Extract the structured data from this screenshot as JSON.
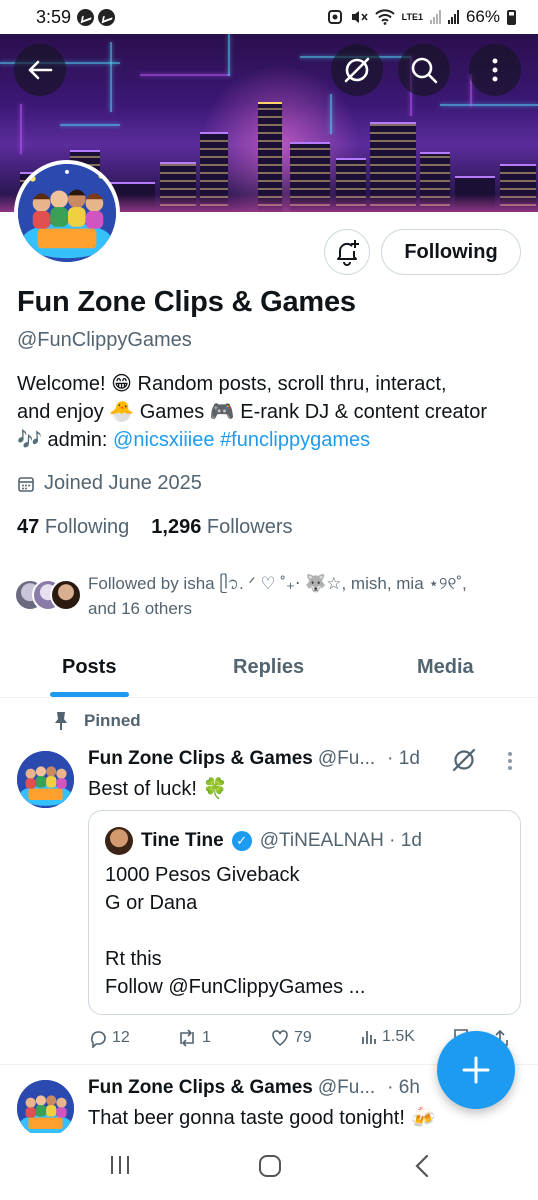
{
  "status_bar": {
    "time": "3:59",
    "network": "LTE1",
    "battery": "66%"
  },
  "header": {
    "back_icon": "arrow-left-icon",
    "grok_icon": "slashed-circle-icon",
    "search_icon": "search-icon",
    "more_icon": "more-vertical-icon"
  },
  "profile": {
    "name": "Fun Zone Clips & Games",
    "handle": "@FunClippyGames",
    "bio_line1": "Welcome! 😁 Random posts, scroll thru, interact,",
    "bio_line2": "and enjoy 🐣 Games 🎮 E-rank DJ & content creator",
    "bio_line3_prefix": "🎶 admin: ",
    "bio_mention": "@nicsxiiiee",
    "bio_hashtag": "#funclippygames",
    "joined": "Joined June 2025",
    "following_count": "47",
    "following_label": "Following",
    "followers_count": "1,296",
    "followers_label": "Followers",
    "followed_by_line1": "Followed by isha ᥫ᭡. ᐟ ♡ ˚₊‧ 🐺☆, mish, mia ⋆୨୧˚,",
    "followed_by_line2": "and 16 others",
    "following_button": "Following"
  },
  "tabs": [
    {
      "label": "Posts",
      "active": true
    },
    {
      "label": "Replies",
      "active": false
    },
    {
      "label": "Media",
      "active": false
    }
  ],
  "pinned_label": "Pinned",
  "posts": [
    {
      "author": "Fun Zone Clips & Games",
      "handle": "@Fu...",
      "time": "· 1d",
      "text": "Best of luck! 🍀",
      "quote": {
        "author": "Tine Tine",
        "handle": "@TiNEALNAH · 1d",
        "lines": [
          "1000 Pesos Giveback",
          "G or Dana",
          "",
          "Rt this",
          "Follow @FunClippyGames ..."
        ]
      },
      "replies": "12",
      "reposts": "1",
      "likes": "79",
      "views": "1.5K"
    },
    {
      "author": "Fun Zone Clips & Games",
      "handle": "@Fu...",
      "time": "· 6h",
      "text": "That beer gonna taste good tonight! 🍻"
    }
  ],
  "colors": {
    "accent": "#1d9bf0",
    "text": "#0f1419",
    "secondary": "#536471"
  }
}
